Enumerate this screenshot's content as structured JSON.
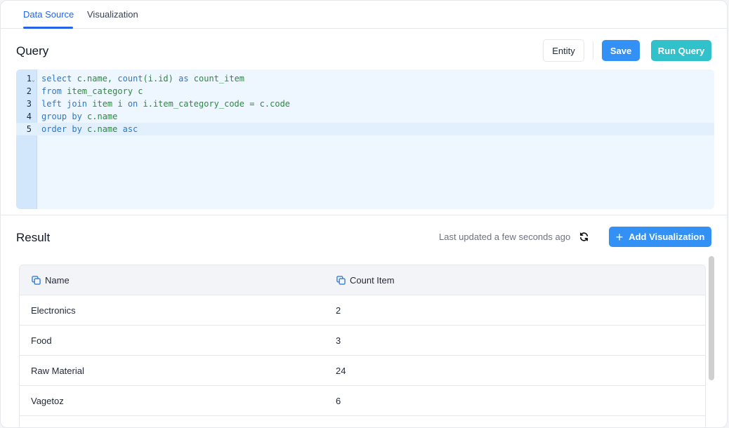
{
  "tabs": [
    {
      "label": "Data Source",
      "active": true
    },
    {
      "label": "Visualization",
      "active": false
    }
  ],
  "query": {
    "title": "Query",
    "buttons": {
      "entity": "Entity",
      "save": "Save",
      "run": "Run Query"
    },
    "editor": {
      "active_line": 5,
      "lines": [
        {
          "num": "1",
          "tokens": [
            {
              "t": "select",
              "k": "kw"
            },
            {
              "t": " c.name, ",
              "k": "id"
            },
            {
              "t": "count",
              "k": "kw"
            },
            {
              "t": "(i.id) ",
              "k": "id"
            },
            {
              "t": "as",
              "k": "kw"
            },
            {
              "t": " count_item",
              "k": "id"
            }
          ]
        },
        {
          "num": "2",
          "tokens": [
            {
              "t": "from",
              "k": "kw"
            },
            {
              "t": " item_category c",
              "k": "id"
            }
          ]
        },
        {
          "num": "3",
          "tokens": [
            {
              "t": "left join",
              "k": "kw"
            },
            {
              "t": " item i ",
              "k": "id"
            },
            {
              "t": "on",
              "k": "kw"
            },
            {
              "t": " i.item_category_code = c.code",
              "k": "id"
            }
          ]
        },
        {
          "num": "4",
          "tokens": [
            {
              "t": "group by",
              "k": "kw"
            },
            {
              "t": " c.name",
              "k": "id"
            }
          ]
        },
        {
          "num": "5",
          "tokens": [
            {
              "t": "order by",
              "k": "kw"
            },
            {
              "t": " c.name ",
              "k": "id"
            },
            {
              "t": "asc",
              "k": "kw"
            }
          ]
        }
      ]
    }
  },
  "result": {
    "title": "Result",
    "last_updated": "Last updated a few seconds ago",
    "add_visualization": "Add Visualization",
    "columns": [
      "Name",
      "Count Item"
    ],
    "rows": [
      [
        "Electronics",
        "2"
      ],
      [
        "Food",
        "3"
      ],
      [
        "Raw Material",
        "24"
      ],
      [
        "Vagetoz",
        "6"
      ]
    ]
  },
  "colors": {
    "primary": "#3390f5",
    "teal": "#30c1cb",
    "tab_active": "#2563eb"
  }
}
